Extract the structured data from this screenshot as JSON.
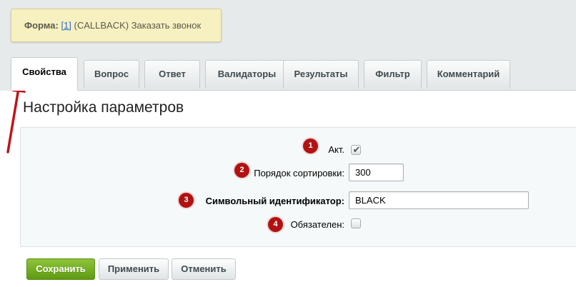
{
  "notice": {
    "label": "Форма:",
    "link": "[1]",
    "text": " (CALLBACK) Заказать звонок"
  },
  "tabs": [
    {
      "label": "Свойства",
      "active": true
    },
    {
      "label": "Вопрос"
    },
    {
      "label": "Ответ"
    },
    {
      "label": "Валидаторы"
    },
    {
      "label": "Результаты"
    },
    {
      "label": "Фильтр"
    },
    {
      "label": "Комментарий"
    }
  ],
  "section_title": "Настройка параметров",
  "fields": {
    "active": {
      "badge": "1",
      "label": "Акт.",
      "checked": true
    },
    "sort": {
      "badge": "2",
      "label": "Порядок сортировки:",
      "value": "300"
    },
    "code": {
      "badge": "3",
      "label": "Символьный идентификатор:",
      "value": "BLACK"
    },
    "required": {
      "badge": "4",
      "label": "Обязателен:",
      "checked": false
    }
  },
  "buttons": {
    "save": "Сохранить",
    "apply": "Применить",
    "cancel": "Отменить"
  },
  "colors": {
    "badge": "#b01212",
    "arrow": "#c0141a",
    "save_button": "#6fac1f",
    "notice_bg": "#f7f1c2"
  },
  "icons": {
    "checkmark": "check-icon",
    "arrow": "annotation-arrow-icon"
  }
}
